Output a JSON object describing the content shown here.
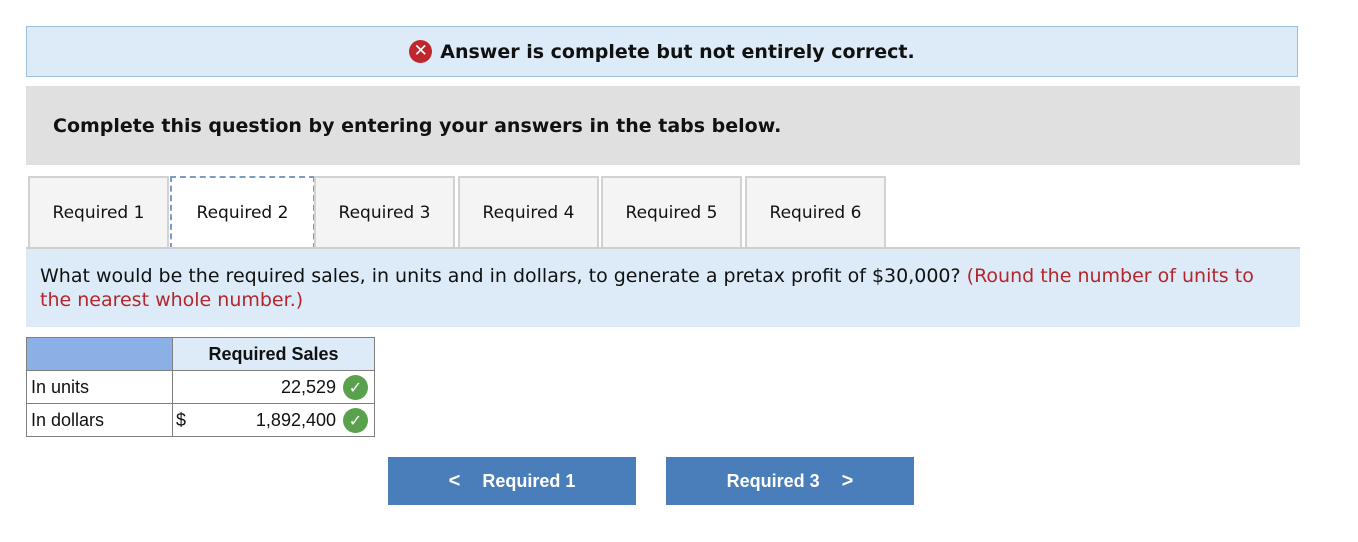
{
  "banner": {
    "text": "Answer is complete but not entirely correct.",
    "icon": "x-icon"
  },
  "instruction": "Complete this question by entering your answers in the tabs below.",
  "tabs": [
    {
      "label": "Required 1"
    },
    {
      "label": "Required 2",
      "active": true
    },
    {
      "label": "Required 3"
    },
    {
      "label": "Required 4"
    },
    {
      "label": "Required 5"
    },
    {
      "label": "Required 6"
    }
  ],
  "question": {
    "text": "What would be the required sales, in units and in dollars, to generate a pretax profit of $30,000?",
    "hint": "(Round the number of units to the nearest whole number.)"
  },
  "table": {
    "header": "Required Sales",
    "rows": [
      {
        "label": "In units",
        "prefix": "",
        "value": "22,529",
        "status": "correct"
      },
      {
        "label": "In dollars",
        "prefix": "$",
        "value": "1,892,400",
        "status": "correct"
      }
    ]
  },
  "nav": {
    "prev_label": "Required 1",
    "prev_icon": "<",
    "next_label": "Required 3",
    "next_icon": ">"
  },
  "colors": {
    "error": "#c0272d",
    "correct": "#5aa14e",
    "button": "#4a7ebb",
    "hint": "#b3262b"
  }
}
